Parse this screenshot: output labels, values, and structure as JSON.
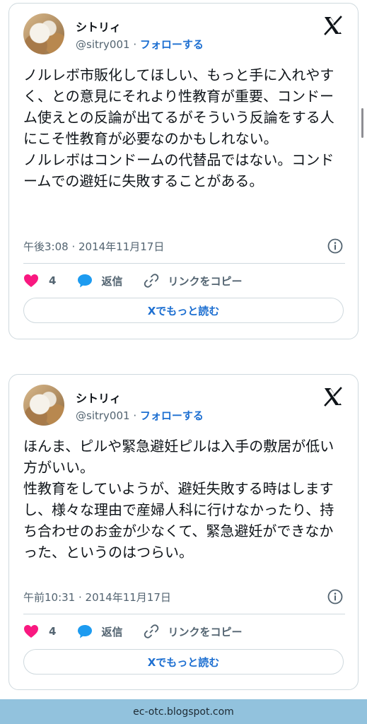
{
  "tweets": [
    {
      "user_name": "シトリィ",
      "handle": "@sitry001",
      "separator": "·",
      "follow_label": "フォローする",
      "text": "ノルレボ市販化してほしい、もっと手に入れやすく、との意見にそれより性教育が重要、コンドーム使えとの反論が出てるがそういう反論をする人にこそ性教育が必要なのかもしれない。\nノルレボはコンドームの代替品ではない。コンドームでの避妊に失敗することがある。",
      "timestamp": "午後3:08 · 2014年11月17日",
      "like_count": "4",
      "reply_label": "返信",
      "copy_link_label": "リンクをコピー",
      "read_more_label": "Xでもっと読む"
    },
    {
      "user_name": "シトリィ",
      "handle": "@sitry001",
      "separator": "·",
      "follow_label": "フォローする",
      "text": "ほんま、ピルや緊急避妊ピルは入手の敷居が低い方がいい。\n性教育をしていようが、避妊失敗する時はしますし、様々な理由で産婦人科に行けなかったり、持ち合わせのお金が少なくて、緊急避妊ができなかった、というのはつらい。",
      "timestamp": "午前10:31 · 2014年11月17日",
      "like_count": "4",
      "reply_label": "返信",
      "copy_link_label": "リンクをコピー",
      "read_more_label": "Xでもっと読む"
    }
  ],
  "footer": {
    "text": "ec-otc.blogspot.com"
  },
  "colors": {
    "accent_link": "#1d6fd1",
    "heart": "#f91880",
    "reply_bubble": "#1d9bf0",
    "footer_bg": "#92c2dd"
  },
  "icons": {
    "brand": "x-logo-icon",
    "info": "info-icon",
    "like": "heart-icon",
    "reply": "speech-bubble-icon",
    "copy": "link-icon"
  }
}
